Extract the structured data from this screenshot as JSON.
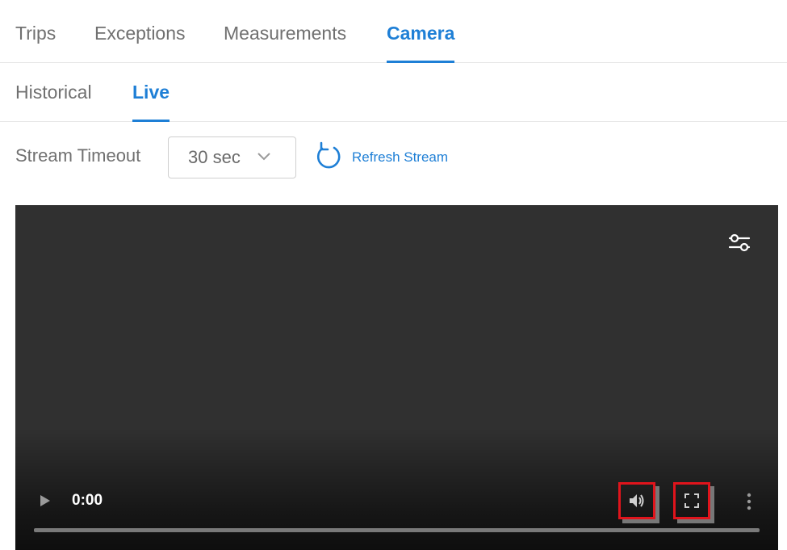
{
  "main_tabs": {
    "trips": "Trips",
    "exceptions": "Exceptions",
    "measurements": "Measurements",
    "camera": "Camera",
    "active": "Camera"
  },
  "sub_tabs": {
    "historical": "Historical",
    "live": "Live",
    "active": "Live"
  },
  "controls": {
    "timeout_label": "Stream Timeout",
    "timeout_value": "30 sec",
    "refresh_label": "Refresh Stream"
  },
  "player": {
    "current_time": "0:00",
    "progress": 0,
    "icons": [
      "settings-icon",
      "play-icon",
      "volume-icon",
      "fullscreen-icon",
      "more-vert-icon"
    ]
  },
  "colors": {
    "accent": "#1e7fd6",
    "player_bg": "#303030",
    "highlight": "#e0141c"
  }
}
